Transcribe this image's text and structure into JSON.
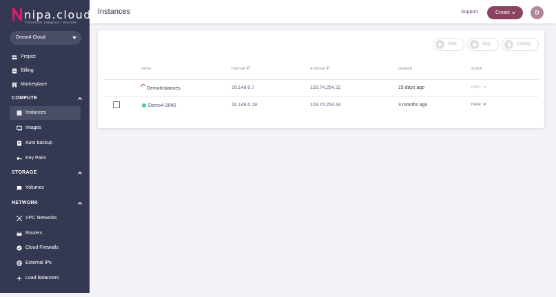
{
  "brand": {
    "logo_text": "nipa.cloud",
    "tagline": "Transform | Migrate | Elevate"
  },
  "cloud_select": {
    "value": "Demo4 Cloud"
  },
  "nav": {
    "project": "Project",
    "billing": "Billing",
    "marketplace": "Marketplace",
    "compute": "COMPUTE",
    "instances": "Instances",
    "images": "Images",
    "auto_backup": "Auto backup",
    "key_pairs": "Key Pairs",
    "storage": "STORAGE",
    "volumes": "Volumes",
    "network": "NETWORK",
    "vpc_networks": "VPC Networks",
    "routers": "Routers",
    "cloud_firewalls": "Cloud Firewalls",
    "external_ips": "External IPs",
    "load_balancers": "Load Balancers"
  },
  "header": {
    "title": "Instances",
    "support": "Support",
    "create": "Create",
    "avatar": "D"
  },
  "actions": {
    "start": "Start",
    "stop": "Stop",
    "destroy": "Destroy"
  },
  "table": {
    "columns": {
      "name": "name",
      "internal_ip": "internal IP",
      "external_ip": "external IP",
      "created": "created",
      "action": "action"
    },
    "rows": [
      {
        "name": "DemoInstances",
        "internal_ip": "10.148.0.7",
        "external_ip": "103.74.254.32",
        "created": "15 days ago",
        "action": "more",
        "status": "building"
      },
      {
        "name": "Demo4-3040",
        "internal_ip": "10.148.0.19",
        "external_ip": "103.74.254.44",
        "created": "3 months ago",
        "action": "more",
        "status": "active"
      }
    ]
  },
  "colors": {
    "sidebar": "#343852",
    "accent": "#8a4461",
    "active_status": "#3ccf9b"
  }
}
